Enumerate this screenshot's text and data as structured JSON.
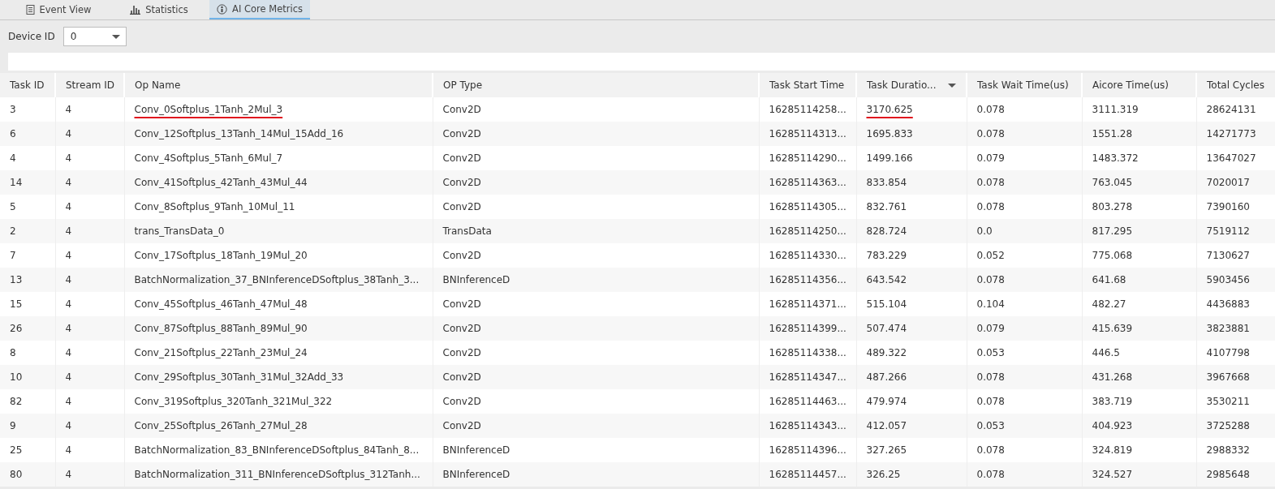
{
  "tabs": [
    {
      "label": "Event View",
      "selected": false
    },
    {
      "label": "Statistics",
      "selected": false
    },
    {
      "label": "AI Core Metrics",
      "selected": true
    }
  ],
  "device_filter": {
    "label": "Device ID",
    "value": "0"
  },
  "table": {
    "columns": [
      {
        "label": "Task ID",
        "sort_descending": false
      },
      {
        "label": "Stream ID",
        "sort_descending": false
      },
      {
        "label": "Op Name",
        "sort_descending": false
      },
      {
        "label": "OP Type",
        "sort_descending": false
      },
      {
        "label": "Task Start Time",
        "sort_descending": false
      },
      {
        "label": "Task Duratio...",
        "sort_descending": true
      },
      {
        "label": "Task Wait Time(us)",
        "sort_descending": false
      },
      {
        "label": "Aicore Time(us)",
        "sort_descending": false
      },
      {
        "label": "Total Cycles",
        "sort_descending": false
      }
    ],
    "rows": [
      {
        "cells": [
          "3",
          "4",
          "Conv_0Softplus_1Tanh_2Mul_3",
          "Conv2D",
          "16285114258...",
          "3170.625",
          "0.078",
          "3111.319",
          "28624131"
        ],
        "red_underline": [
          false,
          false,
          true,
          false,
          false,
          true,
          false,
          false,
          false
        ]
      },
      {
        "cells": [
          "6",
          "4",
          "Conv_12Softplus_13Tanh_14Mul_15Add_16",
          "Conv2D",
          "16285114313...",
          "1695.833",
          "0.078",
          "1551.28",
          "14271773"
        ]
      },
      {
        "cells": [
          "4",
          "4",
          "Conv_4Softplus_5Tanh_6Mul_7",
          "Conv2D",
          "16285114290...",
          "1499.166",
          "0.079",
          "1483.372",
          "13647027"
        ]
      },
      {
        "cells": [
          "14",
          "4",
          "Conv_41Softplus_42Tanh_43Mul_44",
          "Conv2D",
          "16285114363...",
          "833.854",
          "0.078",
          "763.045",
          "7020017"
        ]
      },
      {
        "cells": [
          "5",
          "4",
          "Conv_8Softplus_9Tanh_10Mul_11",
          "Conv2D",
          "16285114305...",
          "832.761",
          "0.078",
          "803.278",
          "7390160"
        ]
      },
      {
        "cells": [
          "2",
          "4",
          "trans_TransData_0",
          "TransData",
          "16285114250...",
          "828.724",
          "0.0",
          "817.295",
          "7519112"
        ]
      },
      {
        "cells": [
          "7",
          "4",
          "Conv_17Softplus_18Tanh_19Mul_20",
          "Conv2D",
          "16285114330...",
          "783.229",
          "0.052",
          "775.068",
          "7130627"
        ]
      },
      {
        "cells": [
          "13",
          "4",
          "BatchNormalization_37_BNInferenceDSoftplus_38Tanh_3...",
          "BNInferenceD",
          "16285114356...",
          "643.542",
          "0.078",
          "641.68",
          "5903456"
        ]
      },
      {
        "cells": [
          "15",
          "4",
          "Conv_45Softplus_46Tanh_47Mul_48",
          "Conv2D",
          "16285114371...",
          "515.104",
          "0.104",
          "482.27",
          "4436883"
        ]
      },
      {
        "cells": [
          "26",
          "4",
          "Conv_87Softplus_88Tanh_89Mul_90",
          "Conv2D",
          "16285114399...",
          "507.474",
          "0.079",
          "415.639",
          "3823881"
        ]
      },
      {
        "cells": [
          "8",
          "4",
          "Conv_21Softplus_22Tanh_23Mul_24",
          "Conv2D",
          "16285114338...",
          "489.322",
          "0.053",
          "446.5",
          "4107798"
        ]
      },
      {
        "cells": [
          "10",
          "4",
          "Conv_29Softplus_30Tanh_31Mul_32Add_33",
          "Conv2D",
          "16285114347...",
          "487.266",
          "0.078",
          "431.268",
          "3967668"
        ]
      },
      {
        "cells": [
          "82",
          "4",
          "Conv_319Softplus_320Tanh_321Mul_322",
          "Conv2D",
          "16285114463...",
          "479.974",
          "0.078",
          "383.719",
          "3530211"
        ]
      },
      {
        "cells": [
          "9",
          "4",
          "Conv_25Softplus_26Tanh_27Mul_28",
          "Conv2D",
          "16285114343...",
          "412.057",
          "0.053",
          "404.923",
          "3725288"
        ]
      },
      {
        "cells": [
          "25",
          "4",
          "BatchNormalization_83_BNInferenceDSoftplus_84Tanh_8...",
          "BNInferenceD",
          "16285114396...",
          "327.265",
          "0.078",
          "324.819",
          "2988332"
        ]
      },
      {
        "cells": [
          "80",
          "4",
          "BatchNormalization_311_BNInferenceDSoftplus_312Tanh...",
          "BNInferenceD",
          "16285114457...",
          "326.25",
          "0.078",
          "324.527",
          "2985648"
        ]
      }
    ]
  }
}
